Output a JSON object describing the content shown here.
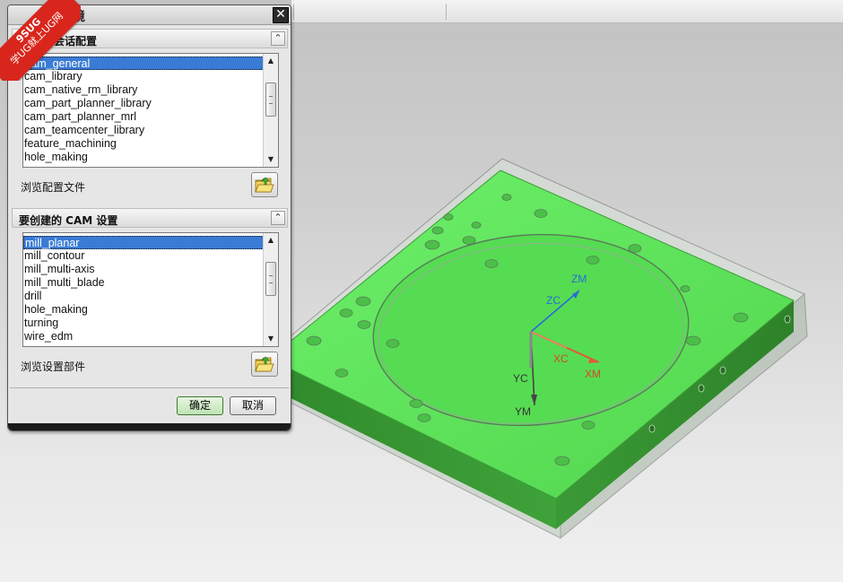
{
  "dialog": {
    "title": "环境",
    "session_section_label": "会话配置",
    "session_configs": [
      "cam_general",
      "cam_library",
      "cam_native_rm_library",
      "cam_part_planner_library",
      "cam_part_planner_mrl",
      "cam_teamcenter_library",
      "feature_machining",
      "hole_making"
    ],
    "browse_config_label": "浏览配置文件",
    "setup_section_label": "要创建的 CAM 设置",
    "cam_setups": [
      "mill_planar",
      "mill_contour",
      "mill_multi-axis",
      "mill_multi_blade",
      "drill",
      "hole_making",
      "turning",
      "wire_edm"
    ],
    "browse_setup_label": "浏览设置部件",
    "ok_label": "确定",
    "cancel_label": "取消",
    "close_symbol": "✕"
  },
  "watermark": {
    "line1": "9SUG",
    "line2": "学UG就上UG网"
  },
  "axes": {
    "zm": "ZM",
    "zc": "ZC",
    "xc": "XC",
    "xm": "XM",
    "yc": "YC",
    "ym": "YM"
  },
  "colors": {
    "part_top": "#5fe35c",
    "part_side": "#2f8a2b",
    "selection": "#3a7bd5",
    "axis_x": "#e05a3a",
    "axis_z": "#2a6ad6",
    "ok_border": "#3d7a2e"
  }
}
